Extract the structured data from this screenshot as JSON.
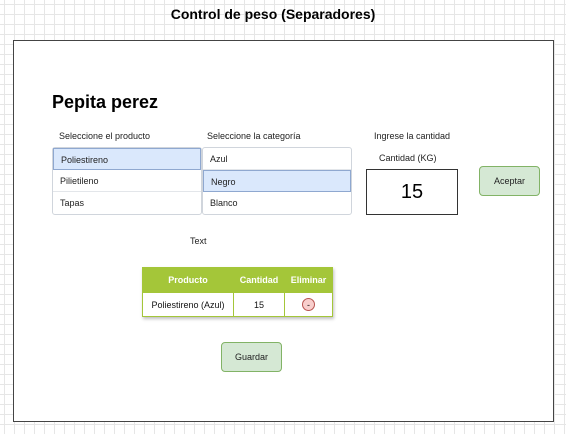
{
  "header": {
    "title": "Control de peso (Separadores)"
  },
  "user": {
    "name": "Pepita perez"
  },
  "product_select": {
    "label": "Seleccione el producto",
    "items": [
      "Poliestireno",
      "Pilietileno",
      "Tapas"
    ],
    "selected": "Poliestireno"
  },
  "category_select": {
    "label": "Seleccione la categoría",
    "items": [
      "Azul",
      "Negro",
      "Blanco"
    ],
    "selected": "Negro"
  },
  "quantity": {
    "label": "Ingrese la cantidad",
    "unit_label": "Cantidad (KG)",
    "value": "15"
  },
  "accept_button": {
    "label": "Aceptar"
  },
  "text_label": "Text",
  "table": {
    "headers": [
      "Producto",
      "Cantidad",
      "Eliminar"
    ],
    "rows": [
      {
        "product": "Poliestireno (Azul)",
        "quantity": "15",
        "remove": "-"
      }
    ]
  },
  "save_button": {
    "label": "Guardar"
  },
  "colors": {
    "selected_bg": "#dae8fc",
    "table_header": "#a4c639",
    "button_green": "#d5e8d4",
    "remove_red": "#f8cecc"
  }
}
